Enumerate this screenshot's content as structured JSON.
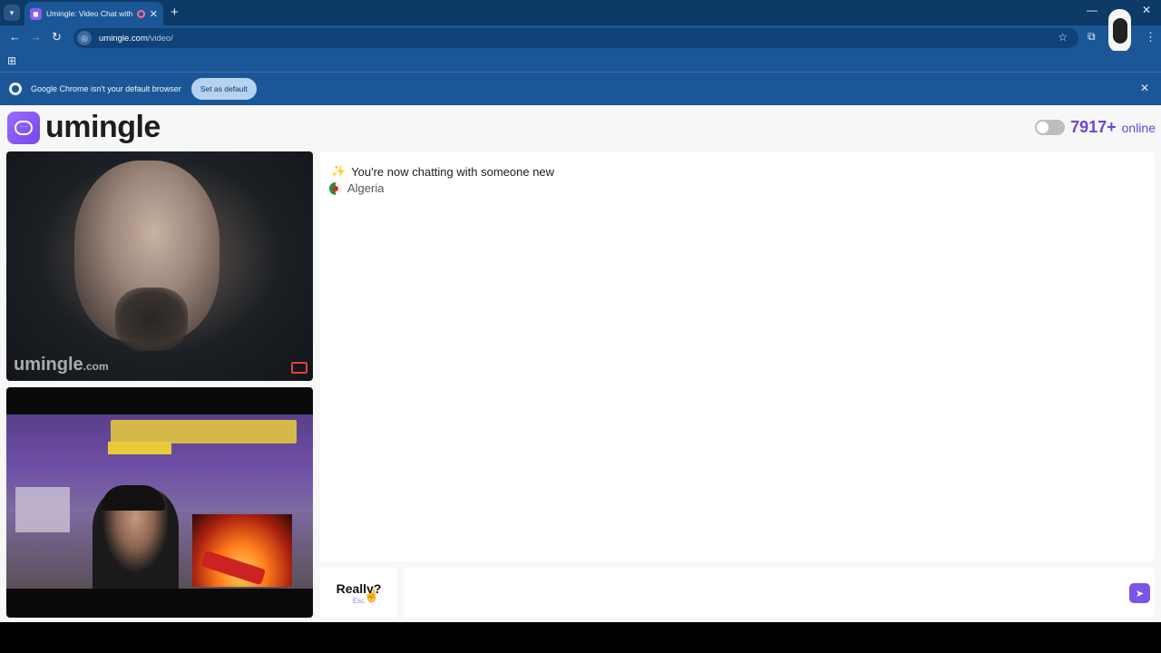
{
  "browser": {
    "tab_title": "Umingle: Video Chat with S",
    "tab_close": "✕",
    "new_tab": "+",
    "url_domain": "umingle.com",
    "url_path": "/video/",
    "infobar_text": "Google Chrome isn't your default browser",
    "set_default_label": "Set as default"
  },
  "site": {
    "logo_text": "umingle",
    "online_count": "7917+",
    "online_label": "online",
    "watermark": "umingle",
    "watermark_domain": ".com"
  },
  "chat": {
    "status_message": "You're now chatting with someone new",
    "country": "Algeria",
    "input_placeholder": ""
  },
  "controls": {
    "skip_label": "Really?",
    "skip_hint": "Esc"
  },
  "icons": {
    "sparkle": "✨",
    "send": "➤"
  },
  "colors": {
    "accent": "#7a55e6",
    "online_text": "#6b45d9",
    "chrome_frame": "#1b5796"
  }
}
